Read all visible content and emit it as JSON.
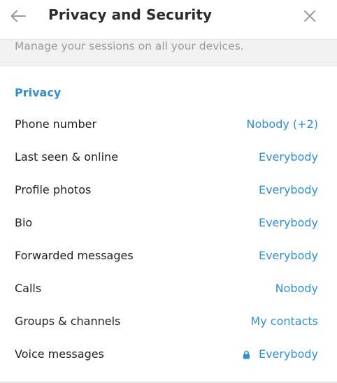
{
  "header": {
    "title": "Privacy and Security",
    "back_icon": "arrow-left-icon",
    "close_icon": "close-icon"
  },
  "sessions": {
    "text": "Manage your sessions on all your devices."
  },
  "privacy": {
    "section_title": "Privacy",
    "rows": [
      {
        "label": "Phone number",
        "value": "Nobody (+2)"
      },
      {
        "label": "Last seen & online",
        "value": "Everybody"
      },
      {
        "label": "Profile photos",
        "value": "Everybody"
      },
      {
        "label": "Bio",
        "value": "Everybody"
      },
      {
        "label": "Forwarded messages",
        "value": "Everybody"
      },
      {
        "label": "Calls",
        "value": "Nobody"
      },
      {
        "label": "Groups & channels",
        "value": "My contacts"
      },
      {
        "label": "Voice messages",
        "value": "Everybody",
        "icon": "lock-icon"
      }
    ]
  },
  "colors": {
    "accent": "#2f8fcf",
    "text": "#222222",
    "muted": "#9a9a9a",
    "band": "#f1f1f1"
  }
}
